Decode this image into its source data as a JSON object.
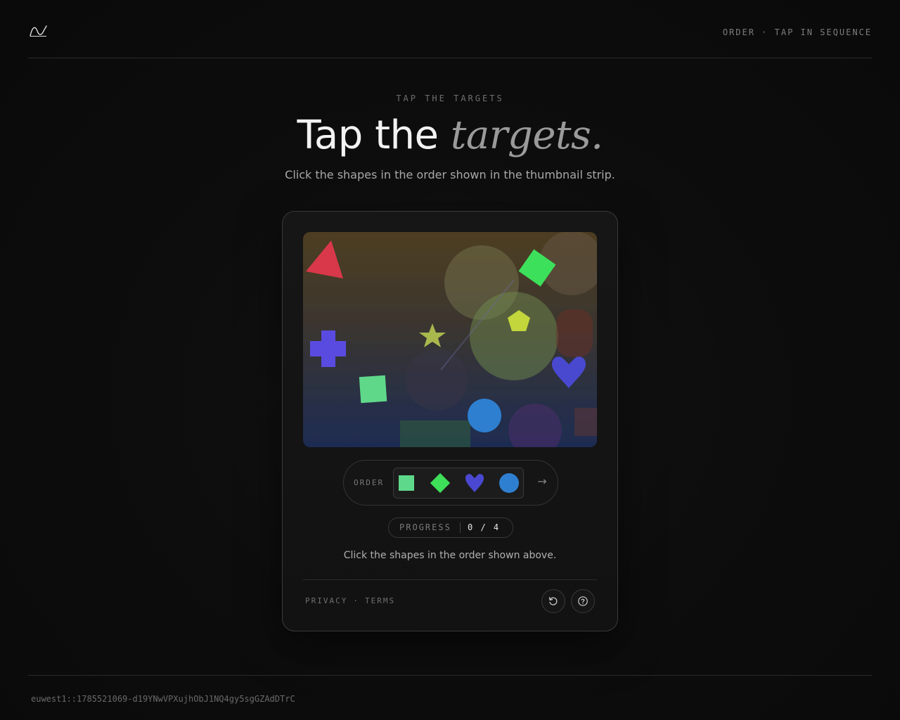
{
  "header": {
    "logo_icon": "wave-logo-icon",
    "mode_label": "ORDER · TAP IN SEQUENCE"
  },
  "hero": {
    "eyebrow": "TAP THE TARGETS",
    "title_plain": "Tap the",
    "title_emphasis": "targets.",
    "subtitle": "Click the shapes in the order shown in the thumbnail strip."
  },
  "challenge": {
    "canvas_shapes": [
      "triangle",
      "diamond",
      "pentagon",
      "star",
      "cross",
      "square",
      "circle",
      "heart"
    ],
    "colors": {
      "red": "#d8384a",
      "green_bright": "#3ee05a",
      "green_pale": "#5ed88a",
      "yellow_green": "#c3d63a",
      "olive": "#a9b84e",
      "blue_purple": "#5a4be0",
      "heart_blue": "#4a48d0",
      "circle_blue": "#2f7fd0"
    },
    "order_label": "ORDER",
    "order_thumbs": [
      "square",
      "diamond",
      "heart",
      "circle"
    ],
    "order_arrow": "→",
    "progress_label": "PROGRESS",
    "progress_value": "0 / 4",
    "instruction": "Click the shapes in the order shown above."
  },
  "card_footer": {
    "privacy": "PRIVACY",
    "separator": "·",
    "terms": "TERMS",
    "refresh_icon": "refresh-icon",
    "help_icon": "help-icon"
  },
  "footer": {
    "session_id": "euwest1::1785521069-d19YNwVPXujhObJ1NQ4gy5sgGZAdDTrC"
  }
}
